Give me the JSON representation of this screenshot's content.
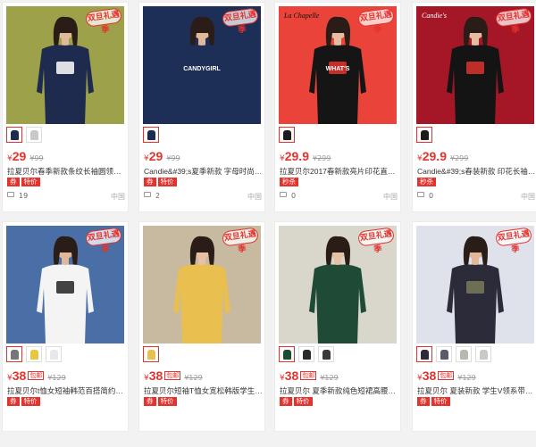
{
  "badge_text": "双旦礼遇季",
  "currency": "¥",
  "colors": {
    "accent": "#e5322d",
    "muted": "#999999"
  },
  "products": [
    {
      "photo": {
        "bg": "#9ca14a",
        "garment": "#1e2b4f",
        "skin": "#e2b89b",
        "label": "",
        "label_color": "#ffffff",
        "label2": "",
        "garment_text": "",
        "graphic": "#ffffff"
      },
      "thumbs": [
        {
          "color": "#1e2b4f"
        },
        {
          "color": "#c9c9c9"
        }
      ],
      "price": "29",
      "tag": "",
      "old_price": "¥99",
      "title": "拉夏贝尔春季新款条纹长袖圆领上衣女...",
      "chips": [
        "券",
        "特价"
      ],
      "comments": "19",
      "origin": "中国"
    },
    {
      "photo": {
        "bg": "#1e2f57",
        "garment": "#1e2f57",
        "skin": "#e2b89b",
        "label": "",
        "label_color": "#ffffff",
        "label2": "",
        "garment_text": "CANDYGIRL",
        "graphic": ""
      },
      "thumbs": [
        {
          "color": "#1e2b4f"
        }
      ],
      "price": "29",
      "tag": "",
      "old_price": "¥99",
      "title": "Candie&#39;s夏季新款 字母时尚圆领...",
      "chips": [
        "券",
        "特价"
      ],
      "comments": "2",
      "origin": "中国"
    },
    {
      "photo": {
        "bg": "#e9433a",
        "garment": "#151515",
        "skin": "#e6bda0",
        "label": "La Chapelle",
        "label_color": "#111111",
        "label2": "",
        "garment_text": "WHAT'S",
        "graphic": "#e5322d"
      },
      "thumbs": [
        {
          "color": "#1b1b1b"
        }
      ],
      "price": "29.9",
      "tag": "",
      "old_price": "¥299",
      "title": "拉夏贝尔2017春新款亮片印花直筒裙...",
      "chips": [
        "秒杀"
      ],
      "comments": "0",
      "origin": "中国"
    },
    {
      "photo": {
        "bg": "#a51727",
        "garment": "#141414",
        "skin": "#e6bda0",
        "label": "Candie's",
        "label_color": "#ffffff",
        "label2": "",
        "garment_text": "",
        "graphic": "#d8342c"
      },
      "thumbs": [
        {
          "color": "#1b1b1b"
        }
      ],
      "price": "29.9",
      "tag": "",
      "old_price": "¥299",
      "title": "Candie&#39;s春装新款 印花长袖圆领...",
      "chips": [
        "秒杀"
      ],
      "comments": "0",
      "origin": "中国"
    },
    {
      "photo": {
        "bg": "#4a6fa6",
        "garment": "#f4f4f4",
        "skin": "#e2b89b",
        "label": "",
        "label_color": "#ffffff",
        "label2": "",
        "garment_text": "",
        "graphic": "#222222"
      },
      "thumbs": [
        {
          "color": "#777777"
        },
        {
          "color": "#e7c640"
        },
        {
          "color": "#e8e8e8"
        }
      ],
      "price": "38",
      "tag": "包邮",
      "old_price": "¥129",
      "title": "拉夏贝尔t恤女短袖韩范百搭简约秋新...",
      "chips": [
        "券",
        "特价"
      ],
      "comments": "",
      "origin": ""
    },
    {
      "photo": {
        "bg": "#c8b9a1",
        "garment": "#e9c04f",
        "skin": "#e8c0a4",
        "label": "",
        "label_color": "#ffffff",
        "label2": "",
        "garment_text": "",
        "graphic": ""
      },
      "thumbs": [
        {
          "color": "#e9c04f"
        }
      ],
      "price": "38",
      "tag": "包邮",
      "old_price": "¥129",
      "title": "拉夏贝尔短袖T恤女宽松韩版学生百搭...",
      "chips": [
        "券",
        "特价"
      ],
      "comments": "",
      "origin": ""
    },
    {
      "photo": {
        "bg": "#d9d6cc",
        "garment": "#1f4a35",
        "skin": "#e6c2a4",
        "label": "",
        "label_color": "#ffffff",
        "label2": "",
        "garment_text": "",
        "graphic": ""
      },
      "thumbs": [
        {
          "color": "#1f4a35"
        },
        {
          "color": "#2a2a2a"
        },
        {
          "color": "#3a3a3a"
        }
      ],
      "price": "38",
      "tag": "包邮",
      "old_price": "¥129",
      "title": "拉夏贝尔 夏季新款纯色短裙高腰A字裙...",
      "chips": [
        "券",
        "特价"
      ],
      "comments": "",
      "origin": ""
    },
    {
      "photo": {
        "bg": "#dfe2ea",
        "garment": "#2b2b3a",
        "skin": "#e2b89b",
        "label": "",
        "label_color": "#ffffff",
        "label2": "",
        "garment_text": "",
        "graphic": "#7a7a5a"
      },
      "thumbs": [
        {
          "color": "#2b2b3a"
        },
        {
          "color": "#5a5a6a"
        },
        {
          "color": "#b8b8b0"
        },
        {
          "color": "#c9c9c9"
        }
      ],
      "price": "38",
      "tag": "包邮",
      "old_price": "¥129",
      "title": "拉夏贝尔 夏装新款 学生V领系带性感...",
      "chips": [
        "券",
        "特价"
      ],
      "comments": "",
      "origin": ""
    }
  ]
}
